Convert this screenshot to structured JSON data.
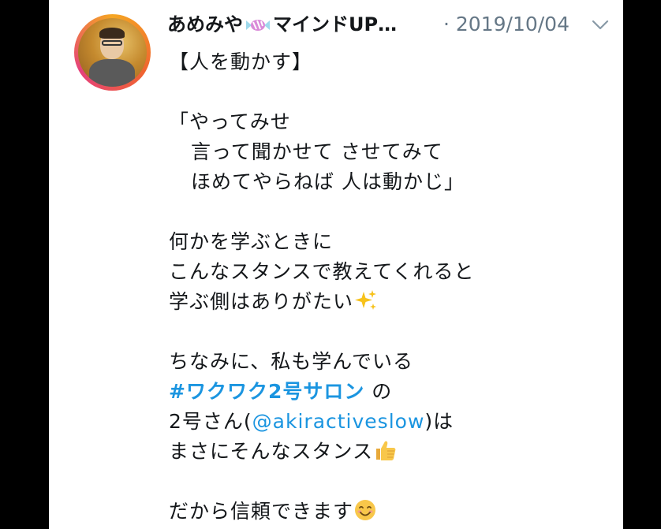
{
  "author": {
    "name": "あめみや",
    "name_suffix": "マインドUP…",
    "date": "2019/10/04"
  },
  "tweet": {
    "title": "【人を動かす】",
    "quote_1": "「やってみせ",
    "quote_2": "言って聞かせて させてみて",
    "quote_3": "ほめてやらねば 人は動かじ」",
    "para2_1": "何かを学ぶときに",
    "para2_2": "こんなスタンスで教えてくれると",
    "para2_3": "学ぶ側はありがたい",
    "para3_1": "ちなみに、私も学んでいる",
    "hashtag": "#ワクワク2号サロン",
    "hashtag_suffix": " の",
    "mention_prefix": "2号さん(",
    "mention": "@akiractiveslow",
    "mention_suffix": ")は",
    "para3_4": "まさにそんなスタンス",
    "closing": "だから信頼できます"
  }
}
